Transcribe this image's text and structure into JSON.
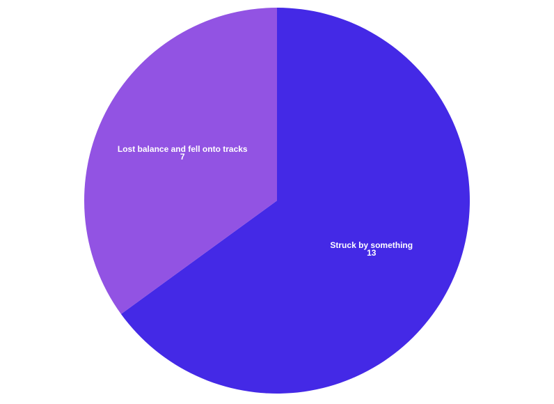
{
  "chart_data": {
    "type": "pie",
    "slices": [
      {
        "label": "Struck by something",
        "value": 13,
        "display_value": "13",
        "color": "#4429e6"
      },
      {
        "label": "Lost balance and fell onto tracks",
        "value": 7,
        "display_value": "7",
        "color": "#9253e3"
      }
    ],
    "start_angle_deg": 0,
    "direction": "clockwise"
  }
}
